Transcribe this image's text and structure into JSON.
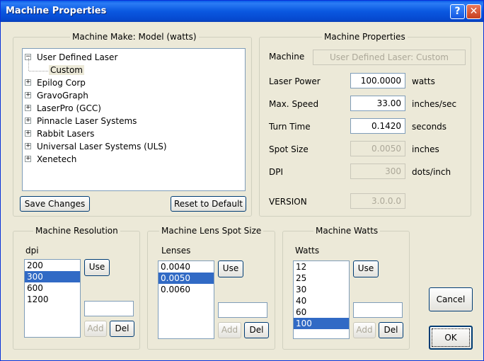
{
  "window": {
    "title": "Machine Properties",
    "help_glyph": "?",
    "close_glyph": "✕"
  },
  "make_group": {
    "title": "Machine Make: Model (watts)",
    "tree": [
      {
        "label": "User Defined Laser",
        "expander": "−"
      },
      {
        "label": "Custom"
      },
      {
        "label": "Epilog Corp",
        "expander": "+"
      },
      {
        "label": "GravoGraph",
        "expander": "+"
      },
      {
        "label": "LaserPro (GCC)",
        "expander": "+"
      },
      {
        "label": "Pinnacle Laser Systems",
        "expander": "+"
      },
      {
        "label": "Rabbit Lasers",
        "expander": "+"
      },
      {
        "label": "Universal Laser Systems (ULS)",
        "expander": "+"
      },
      {
        "label": "Xenetech",
        "expander": "+"
      }
    ],
    "save_label": "Save Changes",
    "reset_label": "Reset to Default"
  },
  "props_group": {
    "title": "Machine Properties",
    "machine_label": "Machine",
    "machine_value": "User Defined Laser: Custom",
    "laser_power_label": "Laser Power",
    "laser_power_value": "100.0000",
    "laser_power_unit": "watts",
    "max_speed_label": "Max. Speed",
    "max_speed_value": "33.00",
    "max_speed_unit": "inches/sec",
    "turn_time_label": "Turn Time",
    "turn_time_value": "0.1420",
    "turn_time_unit": "seconds",
    "spot_size_label": "Spot Size",
    "spot_size_value": "0.0050",
    "spot_size_unit": "inches",
    "dpi_label": "DPI",
    "dpi_value": "300",
    "dpi_unit": "dots/inch",
    "version_label": "VERSION",
    "version_value": "3.0.0.0"
  },
  "resolution_group": {
    "title": "Machine Resolution",
    "list_label": "dpi",
    "items": [
      "200",
      "300",
      "600",
      "1200"
    ],
    "use_label": "Use",
    "add_label": "Add",
    "del_label": "Del"
  },
  "lens_group": {
    "title": "Machine Lens Spot Size",
    "list_label": "Lenses",
    "items": [
      "0.0040",
      "0.0050",
      "0.0060"
    ],
    "use_label": "Use",
    "add_label": "Add",
    "del_label": "Del"
  },
  "watts_group": {
    "title": "Machine Watts",
    "list_label": "Watts",
    "items": [
      "12",
      "25",
      "30",
      "40",
      "60",
      "100"
    ],
    "use_label": "Use",
    "add_label": "Add",
    "del_label": "Del"
  },
  "footer": {
    "cancel_label": "Cancel",
    "ok_label": "OK"
  }
}
